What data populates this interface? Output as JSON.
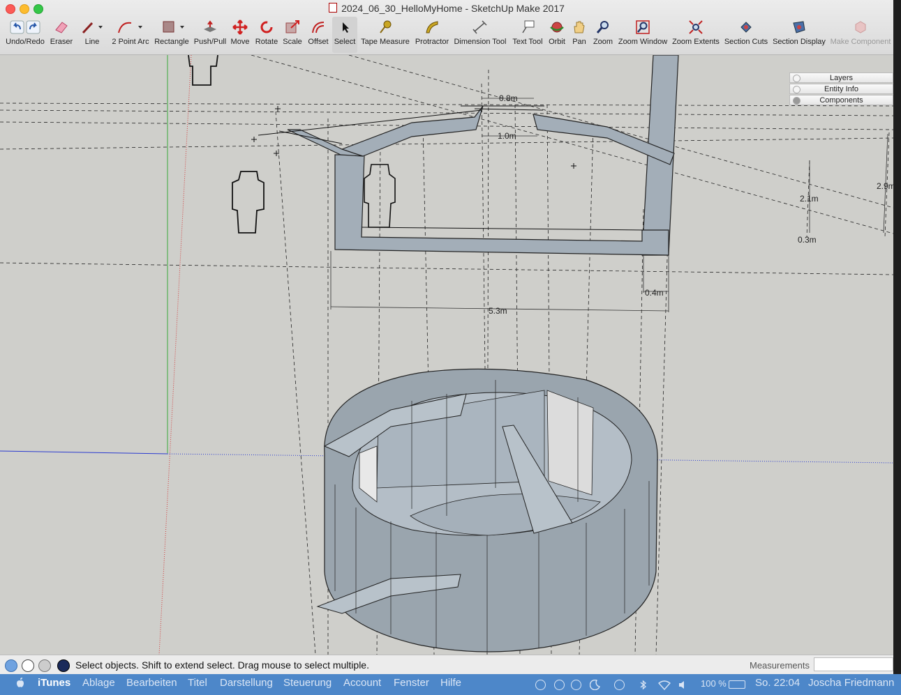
{
  "window": {
    "title": "2024_06_30_HelloMyHome - SketchUp Make 2017"
  },
  "toolbar": {
    "tools": [
      {
        "label": "Undo/Redo",
        "icon": "undo-redo-icon"
      },
      {
        "label": "Eraser",
        "icon": "eraser-icon"
      },
      {
        "label": "Line",
        "icon": "line-pencil-icon"
      },
      {
        "label": "2 Point Arc",
        "icon": "arc-icon"
      },
      {
        "label": "Rectangle",
        "icon": "rectangle-icon"
      },
      {
        "label": "Push/Pull",
        "icon": "push-pull-icon"
      },
      {
        "label": "Move",
        "icon": "move-icon"
      },
      {
        "label": "Rotate",
        "icon": "rotate-icon"
      },
      {
        "label": "Scale",
        "icon": "scale-icon"
      },
      {
        "label": "Offset",
        "icon": "offset-icon"
      },
      {
        "label": "Select",
        "icon": "select-arrow-icon"
      },
      {
        "label": "Tape Measure",
        "icon": "tape-measure-icon"
      },
      {
        "label": "Protractor",
        "icon": "protractor-icon"
      },
      {
        "label": "Dimension Tool",
        "icon": "dimension-icon"
      },
      {
        "label": "Text Tool",
        "icon": "text-tool-icon"
      },
      {
        "label": "Orbit",
        "icon": "orbit-icon"
      },
      {
        "label": "Pan",
        "icon": "pan-hand-icon"
      },
      {
        "label": "Zoom",
        "icon": "zoom-icon"
      },
      {
        "label": "Zoom Window",
        "icon": "zoom-window-icon"
      },
      {
        "label": "Zoom Extents",
        "icon": "zoom-extents-icon"
      },
      {
        "label": "Section Cuts",
        "icon": "section-cuts-icon"
      },
      {
        "label": "Section Display",
        "icon": "section-display-icon"
      },
      {
        "label": "Make Component",
        "icon": "make-component-icon"
      }
    ],
    "active_tool": "Select"
  },
  "tray": {
    "items": [
      "Layers",
      "Entity Info",
      "Components"
    ]
  },
  "dimensions": {
    "d1": "0.8m",
    "d2": "1.0m",
    "d3": "2.1m",
    "d4": "2.9m",
    "d5": "0.3m",
    "d6": "0.4m",
    "d7": "5.3m"
  },
  "statusbar": {
    "hint": "Select objects. Shift to extend select. Drag mouse to select multiple.",
    "measurements_label": "Measurements",
    "measurements_value": ""
  },
  "menubar": {
    "app": "iTunes",
    "items": [
      "Ablage",
      "Bearbeiten",
      "Titel",
      "Darstellung",
      "Steuerung",
      "Account",
      "Fenster",
      "Hilfe"
    ],
    "battery": "100 %",
    "clock": "So. 22:04",
    "user": "Joscha Friedmann"
  },
  "colors": {
    "viewport_bg": "#cfcfcb",
    "model_face": "#a9b4be",
    "model_face_dark": "#8b969f",
    "axis_red": "#d23a3a",
    "axis_green": "#3aaa3a",
    "axis_blue": "#2a3ad0",
    "menubar": "#4d87c9"
  }
}
